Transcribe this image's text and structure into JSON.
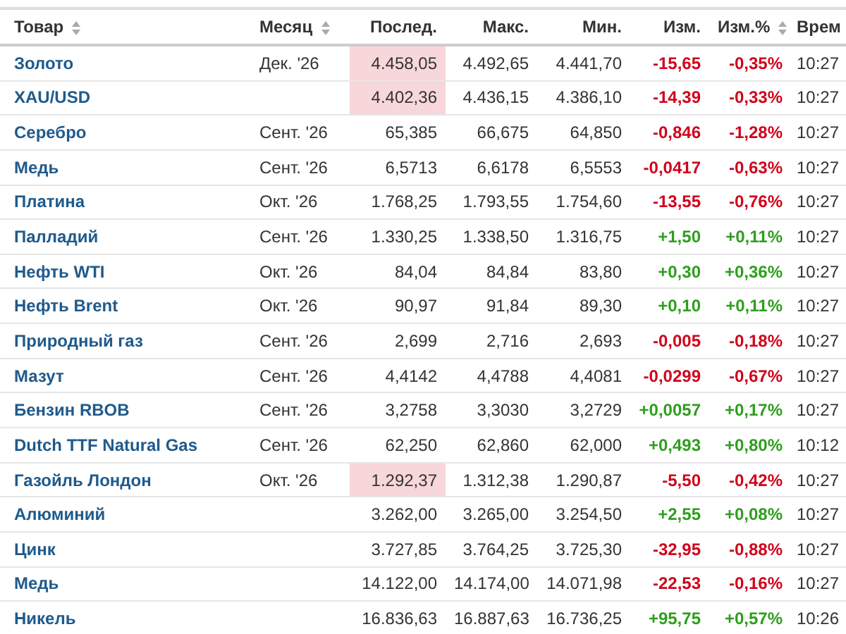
{
  "table": {
    "columns": [
      {
        "label": "Товар",
        "sortable": true
      },
      {
        "label": "Месяц",
        "sortable": true
      },
      {
        "label": "Послед.",
        "sortable": false
      },
      {
        "label": "Макс.",
        "sortable": false
      },
      {
        "label": "Мин.",
        "sortable": false
      },
      {
        "label": "Изм.",
        "sortable": false
      },
      {
        "label": "Изм.%",
        "sortable": true
      },
      {
        "label": "Врем"
      }
    ],
    "rows": [
      {
        "name": "Золото",
        "month": "Дек. '26",
        "last": "4.458,05",
        "highlighted": true,
        "high": "4.492,65",
        "low": "4.441,70",
        "change": "-15,65",
        "change_pct": "-0,35%",
        "rising": false,
        "time": "10:27"
      },
      {
        "name": "XAU/USD",
        "last": "4.402,36",
        "highlighted": true,
        "high": "4.436,15",
        "low": "4.386,10",
        "change": "-14,39",
        "change_pct": "-0,33%",
        "rising": false,
        "time": "10:27"
      },
      {
        "name": "Серебро",
        "month": "Сент. '26",
        "last": "65,385",
        "highlighted": false,
        "high": "66,675",
        "low": "64,850",
        "change": "-0,846",
        "change_pct": "-1,28%",
        "rising": false,
        "time": "10:27"
      },
      {
        "name": "Медь",
        "month": "Сент. '26",
        "last": "6,5713",
        "highlighted": false,
        "high": "6,6178",
        "low": "6,5553",
        "change": "-0,0417",
        "change_pct": "-0,63%",
        "rising": false,
        "time": "10:27"
      },
      {
        "name": "Платина",
        "month": "Окт. '26",
        "last": "1.768,25",
        "highlighted": false,
        "high": "1.793,55",
        "low": "1.754,60",
        "change": "-13,55",
        "change_pct": "-0,76%",
        "rising": false,
        "time": "10:27"
      },
      {
        "name": "Палладий",
        "month": "Сент. '26",
        "last": "1.330,25",
        "highlighted": false,
        "high": "1.338,50",
        "low": "1.316,75",
        "change": "+1,50",
        "change_pct": "+0,11%",
        "rising": true,
        "time": "10:27"
      },
      {
        "name": "Нефть WTI",
        "month": "Окт. '26",
        "last": "84,04",
        "highlighted": false,
        "high": "84,84",
        "low": "83,80",
        "change": "+0,30",
        "change_pct": "+0,36%",
        "rising": true,
        "time": "10:27"
      },
      {
        "name": "Нефть Brent",
        "month": "Окт. '26",
        "last": "90,97",
        "highlighted": false,
        "high": "91,84",
        "low": "89,30",
        "change": "+0,10",
        "change_pct": "+0,11%",
        "rising": true,
        "time": "10:27"
      },
      {
        "name": "Природный газ",
        "month": "Сент. '26",
        "last": "2,699",
        "highlighted": false,
        "high": "2,716",
        "low": "2,693",
        "change": "-0,005",
        "change_pct": "-0,18%",
        "rising": false,
        "time": "10:27"
      },
      {
        "name": "Мазут",
        "month": "Сент. '26",
        "last": "4,4142",
        "highlighted": false,
        "high": "4,4788",
        "low": "4,4081",
        "change": "-0,0299",
        "change_pct": "-0,67%",
        "rising": false,
        "time": "10:27"
      },
      {
        "name": "Бензин RBOB",
        "month": "Сент. '26",
        "last": "3,2758",
        "highlighted": false,
        "high": "3,3030",
        "low": "3,2729",
        "change": "+0,0057",
        "change_pct": "+0,17%",
        "rising": true,
        "time": "10:27"
      },
      {
        "name": "Dutch TTF Natural Gas",
        "month": "Сент. '26",
        "last": "62,250",
        "highlighted": false,
        "high": "62,860",
        "low": "62,000",
        "change": "+0,493",
        "change_pct": "+0,80%",
        "rising": true,
        "time": "10:12"
      },
      {
        "name": "Газойль Лондон",
        "month": "Окт. '26",
        "last": "1.292,37",
        "highlighted": true,
        "high": "1.312,38",
        "low": "1.290,87",
        "change": "-5,50",
        "change_pct": "-0,42%",
        "rising": false,
        "time": "10:27"
      },
      {
        "name": "Алюминий",
        "last": "3.262,00",
        "highlighted": false,
        "high": "3.265,00",
        "low": "3.254,50",
        "change": "+2,55",
        "change_pct": "+0,08%",
        "rising": true,
        "time": "10:27"
      },
      {
        "name": "Цинк",
        "last": "3.727,85",
        "highlighted": false,
        "high": "3.764,25",
        "low": "3.725,30",
        "change": "-32,95",
        "change_pct": "-0,88%",
        "rising": false,
        "time": "10:27"
      },
      {
        "name": "Медь",
        "last": "14.122,00",
        "highlighted": false,
        "high": "14.174,00",
        "low": "14.071,98",
        "change": "-22,53",
        "change_pct": "-0,16%",
        "rising": false,
        "time": "10:27"
      },
      {
        "name": "Никель",
        "last": "16.836,63",
        "highlighted": false,
        "high": "16.887,63",
        "low": "16.736,25",
        "change": "+95,75",
        "change_pct": "+0,57%",
        "rising": true,
        "time": "10:26"
      }
    ]
  }
}
